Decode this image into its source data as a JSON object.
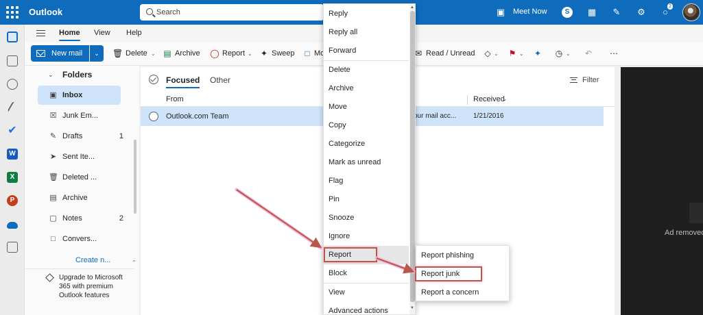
{
  "app": {
    "name": "Outlook"
  },
  "search": {
    "placeholder": "Search"
  },
  "header": {
    "meet_now": "Meet Now",
    "notification_count": "2"
  },
  "ribbon": {
    "tabs": [
      {
        "label": "Home"
      },
      {
        "label": "View"
      },
      {
        "label": "Help"
      }
    ],
    "new_mail": "New mail",
    "delete": "Delete",
    "archive": "Archive",
    "report": "Report",
    "sweep": "Sweep",
    "move_partial": "Mo",
    "read_unread": "Read / Unread"
  },
  "folders": {
    "title": "Folders",
    "items": [
      {
        "label": "Inbox",
        "count": ""
      },
      {
        "label": "Junk Em...",
        "count": ""
      },
      {
        "label": "Drafts",
        "count": "1"
      },
      {
        "label": "Sent Ite...",
        "count": ""
      },
      {
        "label": "Deleted ...",
        "count": ""
      },
      {
        "label": "Archive",
        "count": ""
      },
      {
        "label": "Notes",
        "count": "2"
      },
      {
        "label": "Convers...",
        "count": ""
      }
    ],
    "create_new": "Create n...",
    "upgrade": "Upgrade to Microsoft 365 with premium Outlook features"
  },
  "messages": {
    "tabs": {
      "focused": "Focused",
      "other": "Other"
    },
    "filter": "Filter",
    "columns": {
      "from": "From",
      "received": "Received"
    },
    "rows": [
      {
        "from": "Outlook.com Team",
        "subject": "our mail acc...",
        "date": "1/21/2016"
      }
    ]
  },
  "context_menu": {
    "items": [
      "Reply",
      "Reply all",
      "Forward",
      "Delete",
      "Archive",
      "Move",
      "Copy",
      "Categorize",
      "Mark as unread",
      "Flag",
      "Pin",
      "Snooze",
      "Ignore",
      "Report",
      "Block",
      "View",
      "Advanced actions"
    ]
  },
  "report_submenu": {
    "items": [
      "Report phishing",
      "Report junk",
      "Report a concern"
    ]
  },
  "ad": {
    "text": "Ad removed"
  },
  "colors": {
    "brand": "#0f6cbd",
    "highlight_box": "#b9574b",
    "selection": "#cfe4fa"
  }
}
